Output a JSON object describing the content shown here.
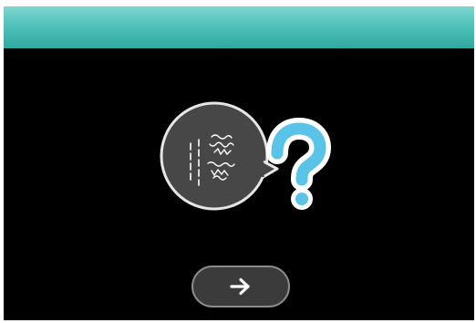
{
  "screen": {
    "header_color": "#4fc2ba",
    "background_color": "#000000"
  },
  "illustration": {
    "bubble_icon": "speech-bubble-icon",
    "symbol": "?",
    "symbol_color": "#59c3e8"
  },
  "next_button": {
    "icon": "arrow-right-icon"
  }
}
